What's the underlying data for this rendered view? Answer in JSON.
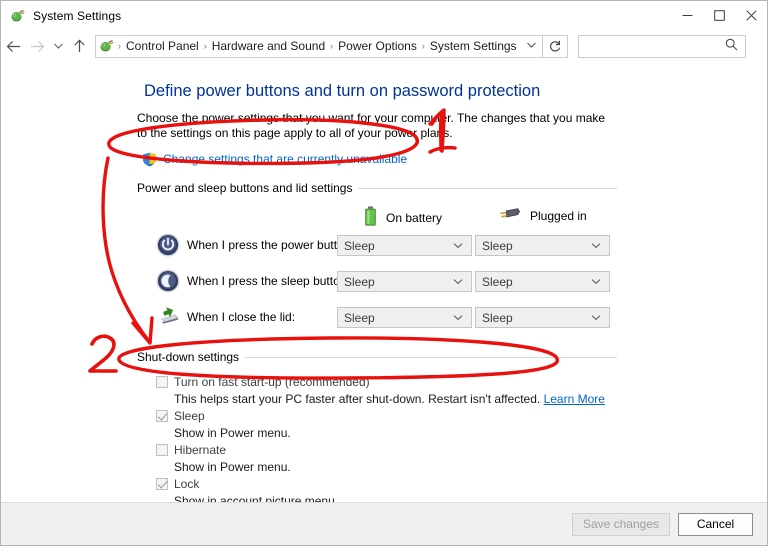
{
  "window": {
    "title": "System Settings",
    "icon": "power-options-icon",
    "controls": {
      "minimize": "minimize-icon",
      "maximize": "maximize-icon",
      "close": "close-icon"
    }
  },
  "navbar": {
    "back": "back-arrow-icon",
    "forward": "forward-arrow-icon",
    "recent": "recent-locations-chevron-icon",
    "up": "up-arrow-icon",
    "address_icon": "control-panel-icon",
    "breadcrumbs": [
      "Control Panel",
      "Hardware and Sound",
      "Power Options",
      "System Settings"
    ],
    "separator": "›",
    "dropdown_arrow": "⌄",
    "refresh": "refresh-icon",
    "search": {
      "value": "",
      "placeholder": "",
      "icon": "search-icon"
    }
  },
  "page": {
    "title": "Define power buttons and turn on password protection",
    "description": "Choose the power settings that you want for your computer. The changes that you make to the settings on this page apply to all of your power plans.",
    "uac_link": {
      "icon": "uac-shield-icon",
      "text": "Change settings that are currently unavailable"
    }
  },
  "power_section": {
    "heading": "Power and sleep buttons and lid settings",
    "columns": [
      {
        "icon": "battery-icon",
        "label": "On battery"
      },
      {
        "icon": "power-plug-icon",
        "label": "Plugged in"
      }
    ],
    "rows": [
      {
        "icon": "power-button-icon",
        "label": "When I press the power button:",
        "on_battery": "Sleep",
        "plugged_in": "Sleep",
        "arrow": "⌄"
      },
      {
        "icon": "sleep-moon-icon",
        "label": "When I press the sleep button:",
        "on_battery": "Sleep",
        "plugged_in": "Sleep",
        "arrow": "⌄"
      },
      {
        "icon": "laptop-lid-icon",
        "label": "When I close the lid:",
        "on_battery": "Sleep",
        "plugged_in": "Sleep",
        "arrow": "⌄"
      }
    ]
  },
  "shutdown_section": {
    "heading": "Shut-down settings",
    "items": [
      {
        "label": "Turn on fast start-up (recommended)",
        "checked": false,
        "sub_text": "This helps start your PC faster after shut-down. Restart isn't affected. ",
        "sub_link": "Learn More"
      },
      {
        "label": "Sleep",
        "checked": true,
        "sub_text": "Show in Power menu.",
        "sub_link": ""
      },
      {
        "label": "Hibernate",
        "checked": false,
        "sub_text": "Show in Power menu.",
        "sub_link": ""
      },
      {
        "label": "Lock",
        "checked": true,
        "sub_text": "Show in account picture menu.",
        "sub_link": ""
      }
    ]
  },
  "footer": {
    "save_label": "Save changes",
    "save_disabled": true,
    "cancel_label": "Cancel"
  },
  "annotations": {
    "color": "#e8110e",
    "marks": [
      {
        "name": "step-1-label",
        "text": "1"
      },
      {
        "name": "step-2-label",
        "text": "2"
      }
    ]
  }
}
